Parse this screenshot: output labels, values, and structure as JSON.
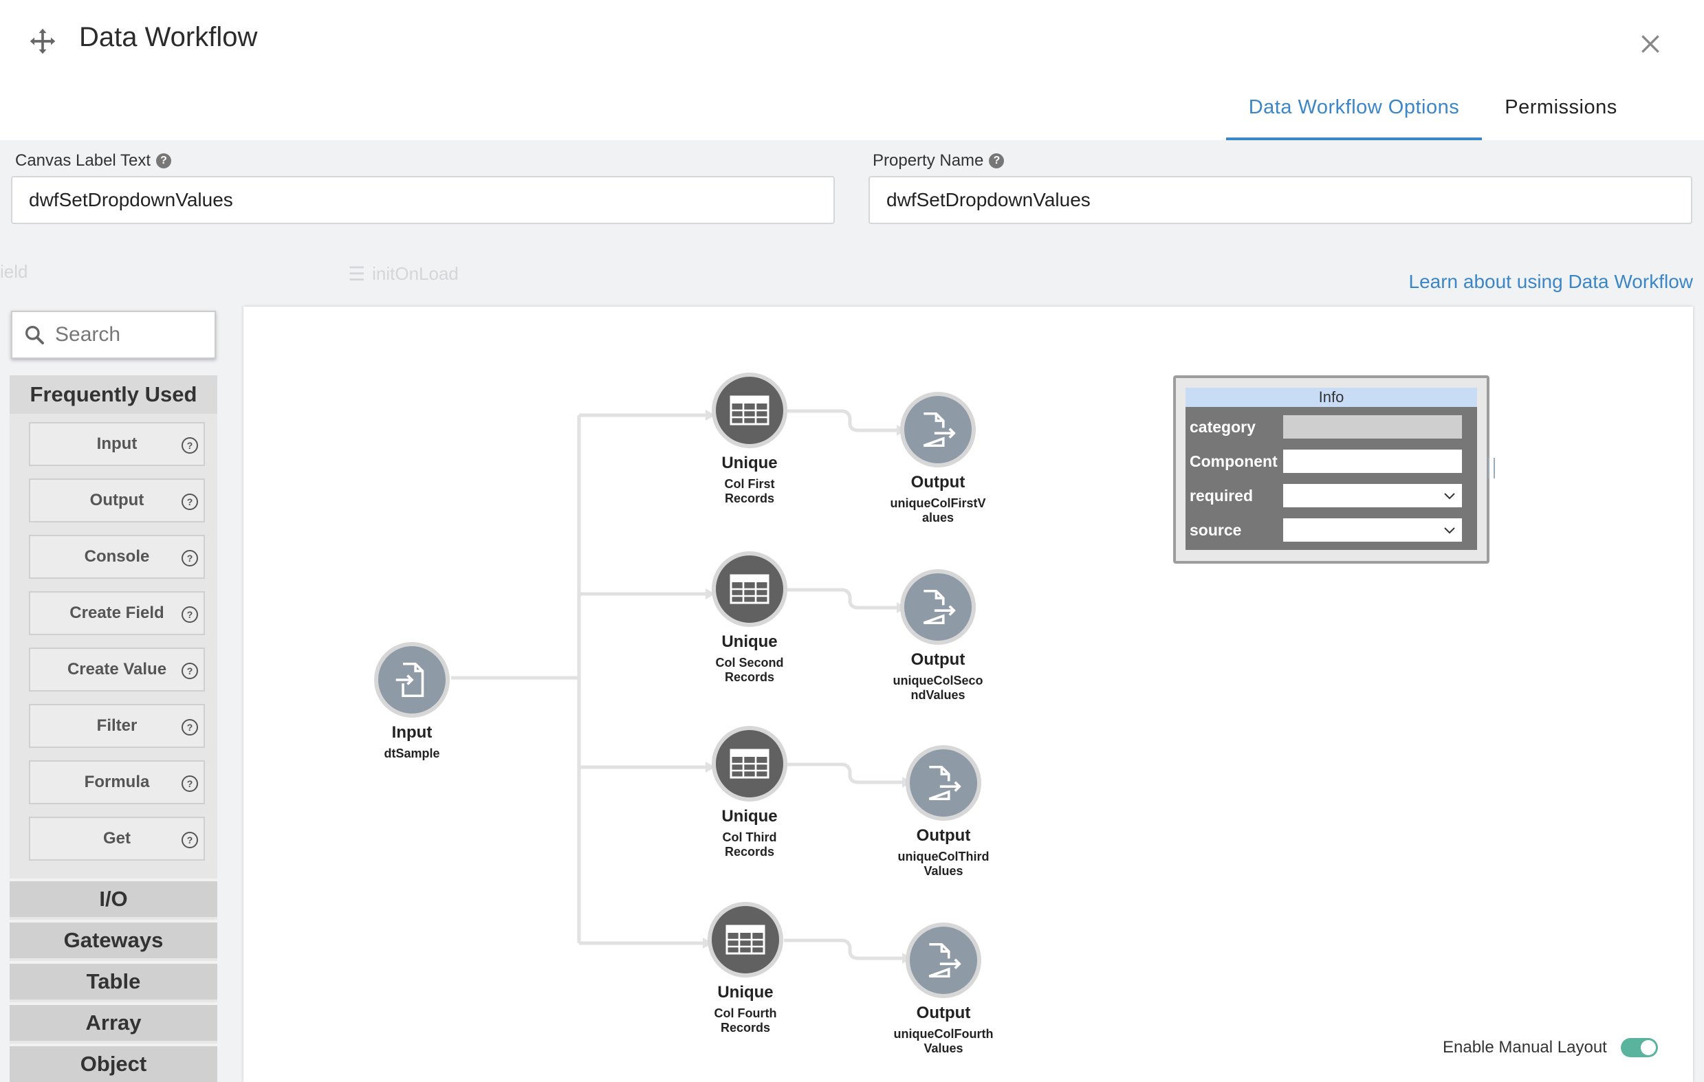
{
  "header": {
    "title": "Data Workflow",
    "tabs": [
      {
        "label": "Data Workflow Options",
        "active": true
      },
      {
        "label": "Permissions",
        "active": false
      }
    ]
  },
  "background_ghost": {
    "left_label": "ield",
    "event_label": "initOnLoad"
  },
  "fields": {
    "canvas_label": {
      "label": "Canvas Label Text",
      "value": "dwfSetDropdownValues"
    },
    "property_name": {
      "label": "Property Name",
      "value": "dwfSetDropdownValues"
    }
  },
  "learn_link": "Learn about using Data Workflow",
  "palette": {
    "search_placeholder": "Search",
    "open_section": "Frequently Used",
    "items": [
      "Input",
      "Output",
      "Console",
      "Create Field",
      "Create Value",
      "Filter",
      "Formula",
      "Get"
    ],
    "sections": [
      "I/O",
      "Gateways",
      "Table",
      "Array",
      "Object"
    ]
  },
  "nodes": [
    {
      "id": "input",
      "kind": "input",
      "title": "Input",
      "sub": "dtSample"
    },
    {
      "id": "u1",
      "kind": "unique",
      "title": "Unique",
      "sub": "Col First Records"
    },
    {
      "id": "u2",
      "kind": "unique",
      "title": "Unique",
      "sub": "Col Second Records"
    },
    {
      "id": "u3",
      "kind": "unique",
      "title": "Unique",
      "sub": "Col Third Records"
    },
    {
      "id": "u4",
      "kind": "unique",
      "title": "Unique",
      "sub": "Col Fourth Records"
    },
    {
      "id": "o1",
      "kind": "output",
      "title": "Output",
      "sub": "uniqueColFirstValues"
    },
    {
      "id": "o2",
      "kind": "output",
      "title": "Output",
      "sub": "uniqueColSecondValues"
    },
    {
      "id": "o3",
      "kind": "output",
      "title": "Output",
      "sub": "uniqueColThirdValues"
    },
    {
      "id": "o4",
      "kind": "output",
      "title": "Output",
      "sub": "uniqueColFourthValues"
    }
  ],
  "info_panel": {
    "title": "Info",
    "rows": [
      {
        "label": "category",
        "value": "",
        "type": "readonly"
      },
      {
        "label": "Component",
        "value": "",
        "type": "text"
      },
      {
        "label": "required",
        "value": "",
        "type": "select"
      },
      {
        "label": "source",
        "value": "",
        "type": "select"
      }
    ]
  },
  "manual_layout": {
    "label": "Enable Manual Layout",
    "enabled": true
  },
  "colors": {
    "accent": "#3a86c8",
    "toggle_on": "#5ab39c",
    "node_dark": "#616161",
    "node_light": "#8e9aa6"
  }
}
